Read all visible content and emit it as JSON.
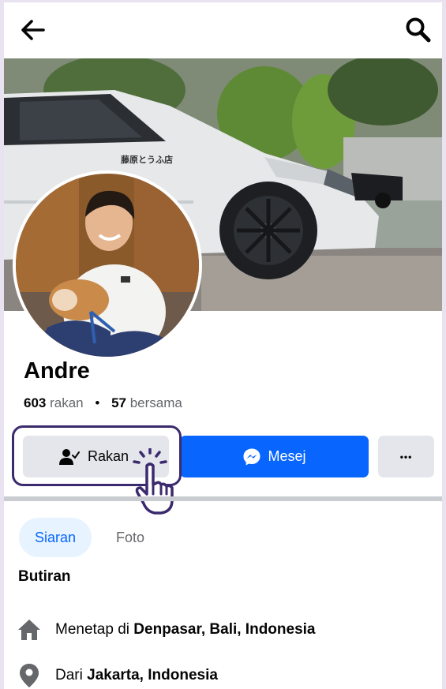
{
  "header": {
    "back_icon": "arrow-left-icon",
    "search_icon": "search-icon"
  },
  "profile": {
    "name": "Andre",
    "friends_count": "603",
    "friends_label": "rakan",
    "separator": "•",
    "mutual_count": "57",
    "mutual_label": "bersama"
  },
  "actions": {
    "friends_label": "Rakan",
    "message_label": "Mesej",
    "more_label": "•••"
  },
  "tabs": [
    {
      "label": "Siaran",
      "active": true
    },
    {
      "label": "Foto",
      "active": false
    }
  ],
  "details": {
    "title": "Butiran",
    "lives_prefix": "Menetap di",
    "lives_value": "Denpasar, Bali, Indonesia",
    "from_prefix": "Dari",
    "from_value": "Jakarta, Indonesia"
  },
  "colors": {
    "accent": "#0866ff",
    "button_gray": "#e4e6eb",
    "highlight": "#3b2a6e"
  }
}
